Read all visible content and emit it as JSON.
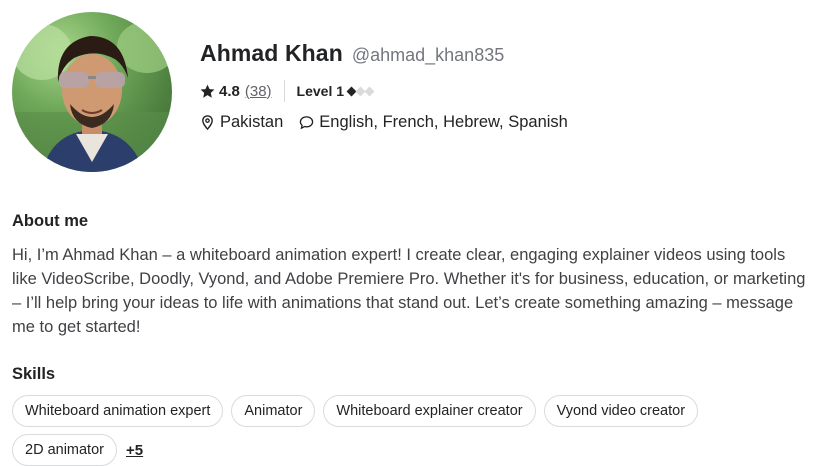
{
  "profile": {
    "name": "Ahmad Khan",
    "handle": "@ahmad_khan835",
    "rating": "4.8",
    "rating_count": "(38)",
    "level_label": "Level 1",
    "level_value": 1,
    "level_max": 3,
    "location": "Pakistan",
    "languages": "English, French, Hebrew, Spanish",
    "avatar_icon": "profile-photo"
  },
  "about": {
    "title": "About me",
    "text": "Hi, I’m Ahmad Khan – a whiteboard animation expert! I create clear, engaging explainer videos using tools like VideoScribe, Doodly, Vyond, and Adobe Premiere Pro. Whether it's for business, education, or marketing – I’ll help bring your ideas to life with animations that stand out. Let’s create something amazing – message me to get started!"
  },
  "skills": {
    "title": "Skills",
    "items": [
      "Whiteboard animation expert",
      "Animator",
      "Whiteboard explainer creator",
      "Vyond video creator",
      "2D animator"
    ],
    "more": "+5"
  },
  "icons": {
    "rating": "star-icon",
    "location": "location-pin-icon",
    "languages": "speech-bubble-icon"
  }
}
